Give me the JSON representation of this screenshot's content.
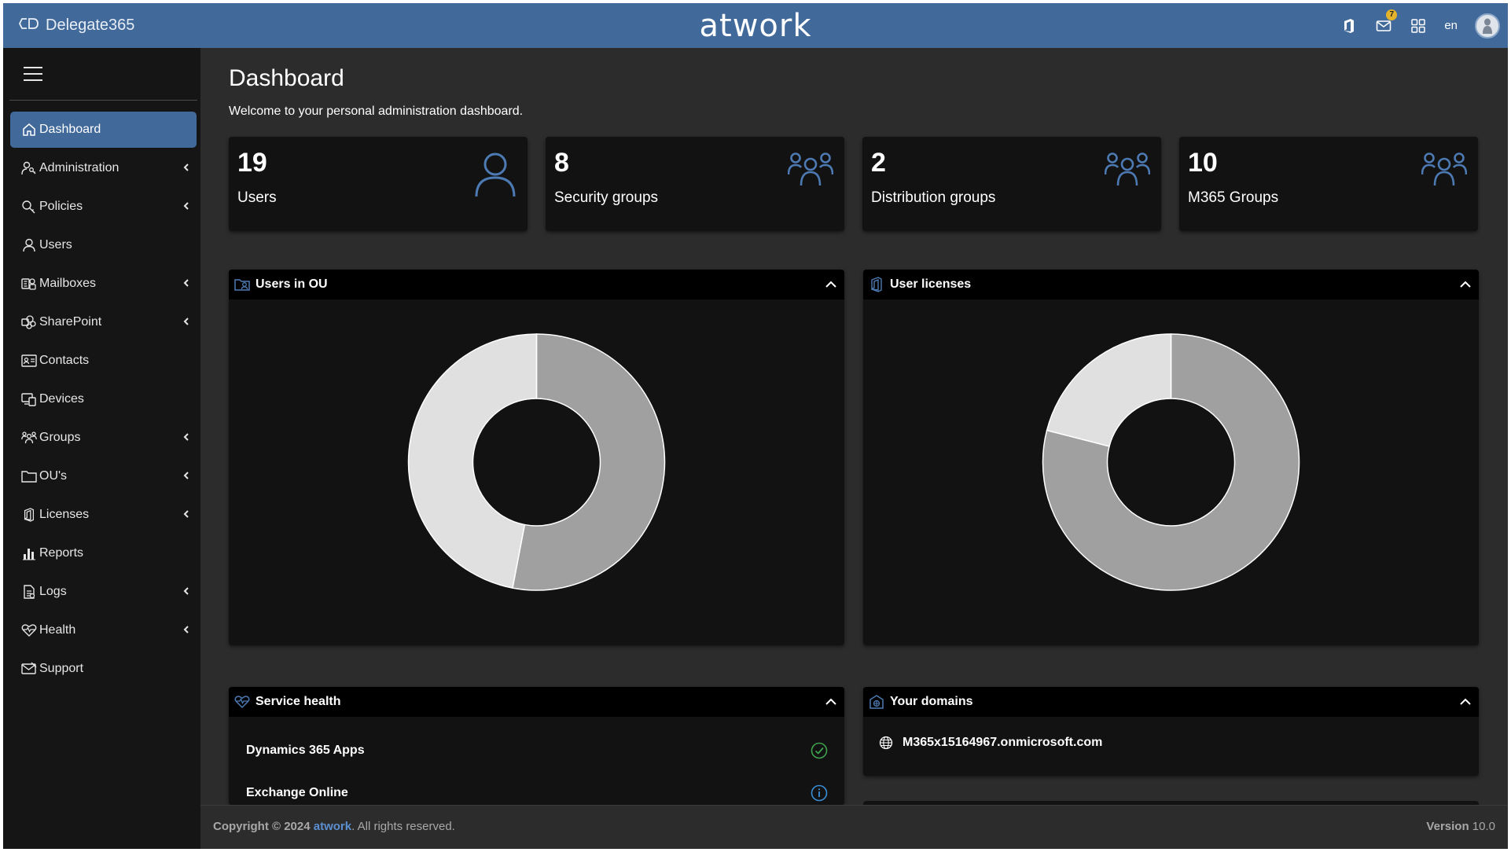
{
  "header": {
    "product_name": "Delegate365",
    "brand": "atwork",
    "notifications_count": "7",
    "language": "en"
  },
  "sidebar": {
    "items": [
      {
        "label": "Dashboard",
        "icon": "home-icon",
        "active": true,
        "has_submenu": false
      },
      {
        "label": "Administration",
        "icon": "user-key-icon",
        "active": false,
        "has_submenu": true
      },
      {
        "label": "Policies",
        "icon": "key-search-icon",
        "active": false,
        "has_submenu": true
      },
      {
        "label": "Users",
        "icon": "user-icon",
        "active": false,
        "has_submenu": false
      },
      {
        "label": "Mailboxes",
        "icon": "exchange-icon",
        "active": false,
        "has_submenu": true
      },
      {
        "label": "SharePoint",
        "icon": "sharepoint-icon",
        "active": false,
        "has_submenu": true
      },
      {
        "label": "Contacts",
        "icon": "contact-card-icon",
        "active": false,
        "has_submenu": false
      },
      {
        "label": "Devices",
        "icon": "devices-icon",
        "active": false,
        "has_submenu": false
      },
      {
        "label": "Groups",
        "icon": "groups-icon",
        "active": false,
        "has_submenu": true
      },
      {
        "label": "OU's",
        "icon": "folder-icon",
        "active": false,
        "has_submenu": true
      },
      {
        "label": "Licenses",
        "icon": "office-icon",
        "active": false,
        "has_submenu": true
      },
      {
        "label": "Reports",
        "icon": "bar-chart-icon",
        "active": false,
        "has_submenu": false
      },
      {
        "label": "Logs",
        "icon": "log-file-icon",
        "active": false,
        "has_submenu": true
      },
      {
        "label": "Health",
        "icon": "heart-pulse-icon",
        "active": false,
        "has_submenu": true
      },
      {
        "label": "Support",
        "icon": "support-envelope-icon",
        "active": false,
        "has_submenu": false
      }
    ]
  },
  "main": {
    "title": "Dashboard",
    "subtitle": "Welcome to your personal administration dashboard.",
    "stats": [
      {
        "value": "19",
        "label": "Users",
        "icon": "user-icon"
      },
      {
        "value": "8",
        "label": "Security groups",
        "icon": "groups-icon"
      },
      {
        "value": "2",
        "label": "Distribution groups",
        "icon": "groups-icon"
      },
      {
        "value": "10",
        "label": "M365 Groups",
        "icon": "groups-icon"
      }
    ],
    "panels": {
      "users_in_ou": {
        "title": "Users in OU"
      },
      "user_licenses": {
        "title": "User licenses"
      },
      "service_health": {
        "title": "Service health",
        "rows": [
          {
            "name": "Dynamics 365 Apps",
            "status": "healthy",
            "status_color": "#3fa34d"
          },
          {
            "name": "Exchange Online",
            "status": "info",
            "status_color": "#3b8fd6"
          }
        ]
      },
      "your_domains": {
        "title": "Your domains",
        "domains": [
          "M365x15164967.onmicrosoft.com"
        ]
      }
    }
  },
  "chart_data": [
    {
      "type": "pie",
      "slices": [
        {
          "value": 53,
          "color": "#a0a0a0"
        },
        {
          "value": 47,
          "color": "#e0e0e0"
        }
      ]
    },
    {
      "type": "pie",
      "slices": [
        {
          "value": 79,
          "color": "#a0a0a0"
        },
        {
          "value": 21,
          "color": "#e0e0e0"
        }
      ]
    }
  ],
  "footer": {
    "copyright_prefix": "Copyright © 2024",
    "company": "atwork",
    "suffix": ". All rights reserved.",
    "version_label": "Version",
    "version_number": "10.0"
  },
  "colors": {
    "accent": "#41699a",
    "link": "#5b8fd0",
    "sidebar_bg": "#151515",
    "content_bg": "#2c2c2c",
    "card_bg": "#121212"
  }
}
